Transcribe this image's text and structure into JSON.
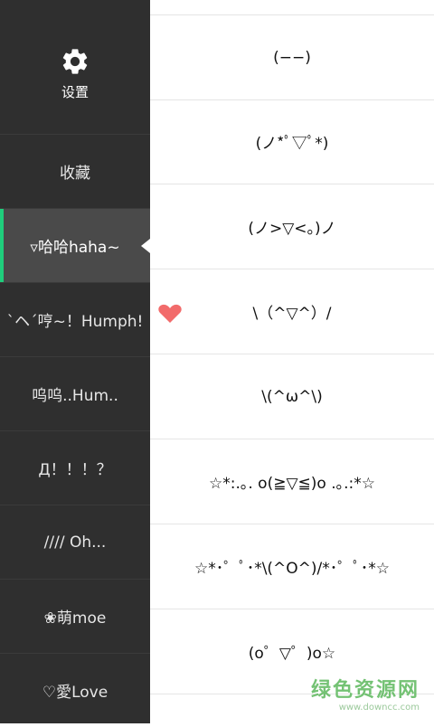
{
  "settings": {
    "label": "设置",
    "icon": "gear-icon"
  },
  "categories": [
    {
      "label": "收藏"
    },
    {
      "label": "▿哈哈haha~",
      "active": true
    },
    {
      "label": "`ヘ´哼~！Humph!"
    },
    {
      "label": "呜呜..Hum.."
    },
    {
      "label": "Д！！！？"
    },
    {
      "label": "//// Oh..."
    },
    {
      "label": "❀萌moe"
    },
    {
      "label": "♡愛Love"
    }
  ],
  "emoticons": [
    "(−−)",
    "(ノ*ﾟ▽ﾟ*)",
    "(ノ>▽<。)ノ",
    "\\（^▽^）/",
    "\\(^ω^\\)",
    "☆*:.｡. o(≧▽≦)o .｡.:*☆",
    "☆*･゜ﾟ･*\\(^O^)/*･゜ﾟ･*☆",
    "(o゜▽゜)o☆"
  ],
  "favorite_row_index": 3,
  "colors": {
    "sidebar": "#2f2f2f",
    "active_item": "#4a4a4a",
    "accent": "#1fce7c",
    "heart": "#f26b6b"
  },
  "watermark": {
    "title": "绿色资源网",
    "url": "www.downcc.com"
  }
}
